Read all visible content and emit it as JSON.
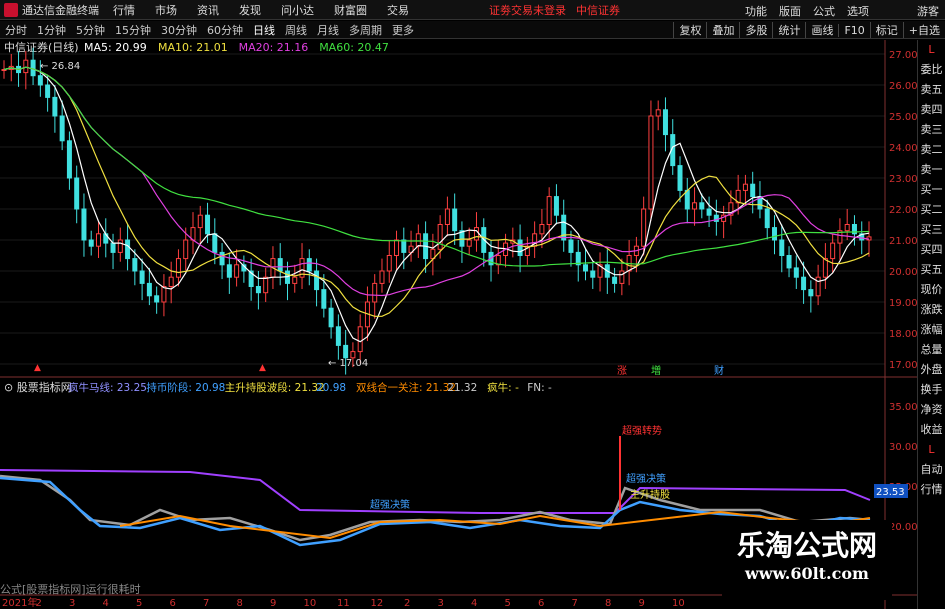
{
  "app": {
    "name": "通达信金融终端",
    "notice": "证劵交易未登录",
    "broker": "中信证券",
    "guest": "游客"
  },
  "menu": [
    "行情",
    "市场",
    "资讯",
    "发现",
    "问小达",
    "财富圈",
    "交易"
  ],
  "topright": [
    "功能",
    "版面",
    "公式",
    "选项"
  ],
  "periods": [
    "分时",
    "1分钟",
    "5分钟",
    "15分钟",
    "30分钟",
    "60分钟",
    "日线",
    "周线",
    "月线",
    "多周期",
    "更多"
  ],
  "active_period": "日线",
  "tools": [
    "复权",
    "叠加",
    "多股",
    "统计",
    "画线",
    "F10",
    "标记",
    "+自选"
  ],
  "main_chart": {
    "title": "中信证券(日线)",
    "ma": [
      {
        "label": "MA5: 20.99",
        "color": "#ffffff"
      },
      {
        "label": "MA10: 21.01",
        "color": "#f0e040"
      },
      {
        "label": "MA20: 21.16",
        "color": "#e040e0"
      },
      {
        "label": "MA60: 20.47",
        "color": "#40e040"
      }
    ],
    "y_ticks": [
      "27.00",
      "26.00",
      "25.00",
      "24.00",
      "23.00",
      "22.00",
      "21.00",
      "20.00",
      "19.00",
      "18.00",
      "17.00"
    ],
    "high_label": "26.84",
    "low_label": "17.04",
    "markers": [
      {
        "text": "涨",
        "color": "#ff3333"
      },
      {
        "text": "増",
        "color": "#40e040"
      },
      {
        "text": "财",
        "color": "#40a0ff"
      }
    ]
  },
  "indicator": {
    "name": "股票指标网",
    "items": [
      {
        "label": "疯牛马线: 23.25",
        "color": "#9090ff"
      },
      {
        "label": "持币阶段: 20.98",
        "color": "#40a0ff"
      },
      {
        "label": "主升持股波段: 21.32",
        "color": "#f0e040"
      },
      {
        "label": "20.98",
        "color": "#40a0ff"
      },
      {
        "label": "双线合一关注: 21.32",
        "color": "#ff8c00"
      },
      {
        "label": "21.32",
        "color": "#cccccc"
      },
      {
        "label": "疯牛: -",
        "color": "#f0e040"
      },
      {
        "label": "FN: -",
        "color": "#cccccc"
      }
    ],
    "y_ticks": [
      "35.00",
      "30.00",
      "25.00",
      "20.00"
    ],
    "current_value": "23.53",
    "annotations": [
      "超强转势",
      "超强决策",
      "超强决策",
      "主升持股"
    ]
  },
  "right_tabs": [
    "L",
    "委比",
    "卖五",
    "卖四",
    "卖三",
    "卖二",
    "卖一",
    "买一",
    "买二",
    "买三",
    "买四",
    "买五",
    "现价",
    "涨跌",
    "涨幅",
    "总量",
    "外盘",
    "换手",
    "净资",
    "收益",
    "L",
    "自动",
    "行情"
  ],
  "x_labels": [
    "2021年",
    "2",
    "3",
    "4",
    "5",
    "6",
    "7",
    "8",
    "9",
    "10",
    "11",
    "12",
    "2",
    "3",
    "4",
    "5",
    "6",
    "7",
    "8",
    "9",
    "10"
  ],
  "status": "公式[股票指标网]运行很耗时",
  "watermark": {
    "line1": "乐淘公式网",
    "line2": "www.60lt.com"
  }
}
